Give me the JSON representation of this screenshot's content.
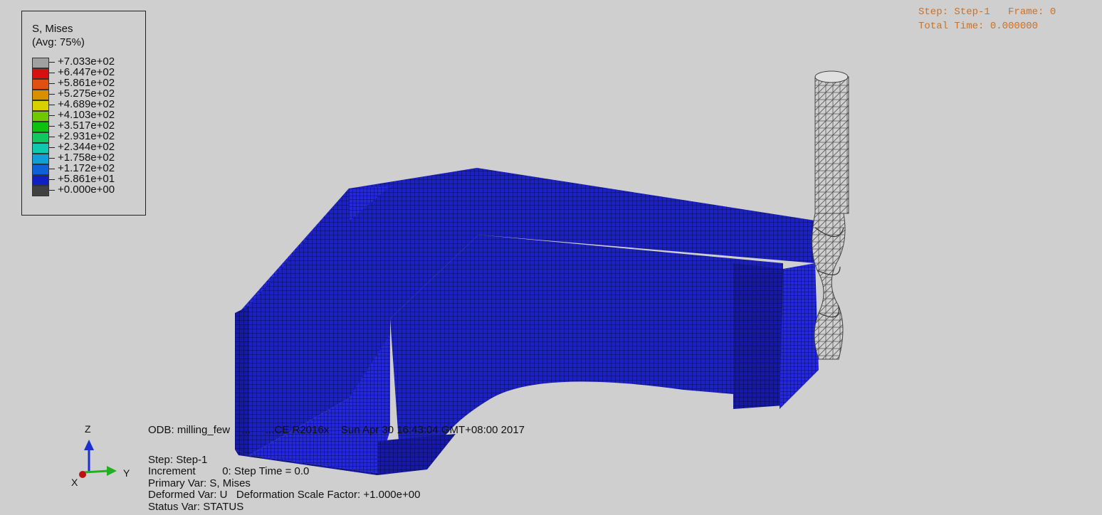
{
  "legend": {
    "title_line1": "S, Mises",
    "title_line2": "(Avg: 75%)",
    "entries": [
      {
        "label": "+7.033e+02",
        "color": "#a0a0a0"
      },
      {
        "label": "+6.447e+02",
        "color": "#d81010"
      },
      {
        "label": "+5.861e+02",
        "color": "#e05010"
      },
      {
        "label": "+5.275e+02",
        "color": "#d89000"
      },
      {
        "label": "+4.689e+02",
        "color": "#d8d000"
      },
      {
        "label": "+4.103e+02",
        "color": "#70c800"
      },
      {
        "label": "+3.517e+02",
        "color": "#10c010"
      },
      {
        "label": "+2.931e+02",
        "color": "#10c860"
      },
      {
        "label": "+2.344e+02",
        "color": "#10c8b0"
      },
      {
        "label": "+1.758e+02",
        "color": "#10a0d8"
      },
      {
        "label": "+1.172e+02",
        "color": "#1060d8"
      },
      {
        "label": "+5.861e+01",
        "color": "#1020c0"
      },
      {
        "label": "+0.000e+00",
        "color": "#404040"
      }
    ]
  },
  "state_block": {
    "line1": "Step: Step-1   Frame: 0",
    "line2": "Total Time: 0.000000"
  },
  "info_block": {
    "odb_line": "ODB: milling_few    ...     ...CE R2016x    Sun Apr 30 16:43:04 GMT+08:00 2017",
    "step_line": "Step: Step-1",
    "increment_line": "Increment         0: Step Time = 0.0",
    "primary_var_line": "Primary Var: S, Mises",
    "deformed_var_line": "Deformed Var: U   Deformation Scale Factor: +1.000e+00",
    "status_var_line": "Status Var: STATUS"
  },
  "triad": {
    "z_label": "Z",
    "y_label": "Y",
    "x_label": "X",
    "colors": {
      "z": "#1a2fd0",
      "y": "#20b020",
      "x": "#c01010"
    }
  },
  "model": {
    "workpiece_color": "#1a1ec8",
    "tool_color": "#c8c8c8"
  }
}
